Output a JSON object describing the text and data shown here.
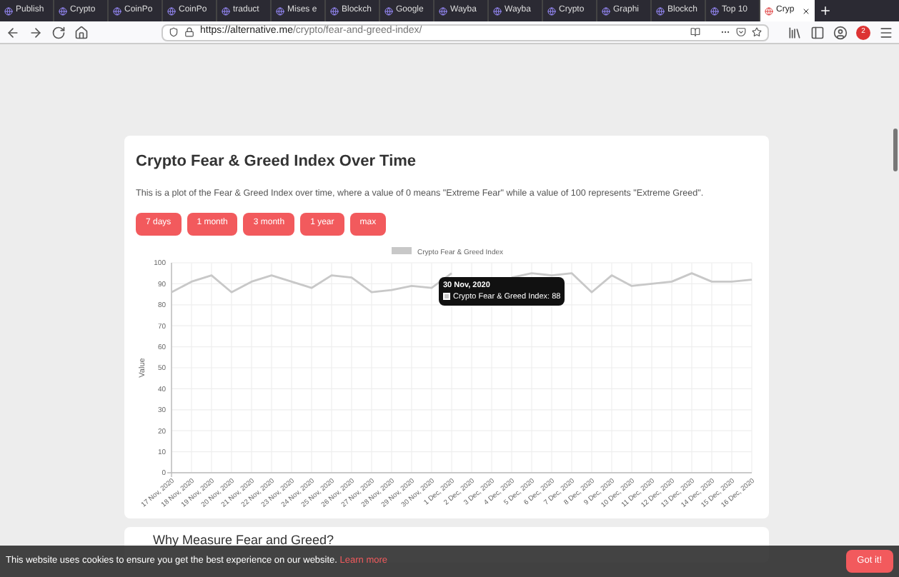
{
  "browser": {
    "tabs": [
      {
        "label": "Publish",
        "selected": false
      },
      {
        "label": "Crypto",
        "selected": false
      },
      {
        "label": "CoinPo",
        "selected": false
      },
      {
        "label": "CoinPo",
        "selected": false
      },
      {
        "label": "traduct",
        "selected": false
      },
      {
        "label": "Mises e",
        "selected": false
      },
      {
        "label": "Blockch",
        "selected": false
      },
      {
        "label": "Google",
        "selected": false
      },
      {
        "label": "Wayba",
        "selected": false
      },
      {
        "label": "Wayba",
        "selected": false
      },
      {
        "label": "Crypto",
        "selected": false
      },
      {
        "label": "Graphi",
        "selected": false
      },
      {
        "label": "Blockch",
        "selected": false
      },
      {
        "label": "Top 10",
        "selected": false
      },
      {
        "label": "Cryp",
        "selected": true
      }
    ],
    "url_host": "https://alternative.me",
    "url_path": "/crypto/fear-and-greed-index/",
    "adblock_count": "2"
  },
  "card": {
    "title": "Crypto Fear & Greed Index Over Time",
    "description": "This is a plot of the Fear & Greed Index over time, where a value of 0 means \"Extreme Fear\" while a value of 100 represents \"Extreme Greed\".",
    "buttons": [
      "7 days",
      "1 month",
      "3 month",
      "1 year",
      "max"
    ],
    "tooltip": {
      "title": "30 Nov, 2020",
      "label": "Crypto Fear & Greed Index: 88"
    },
    "chart_data": {
      "type": "line",
      "grid": true,
      "ylabel": "Value",
      "ylim": [
        0,
        100
      ],
      "yticks": [
        0,
        10,
        20,
        30,
        40,
        50,
        60,
        70,
        80,
        90,
        100
      ],
      "categories": [
        "17 Nov, 2020",
        "18 Nov, 2020",
        "19 Nov, 2020",
        "20 Nov, 2020",
        "21 Nov, 2020",
        "22 Nov, 2020",
        "23 Nov, 2020",
        "24 Nov, 2020",
        "25 Nov, 2020",
        "26 Nov, 2020",
        "27 Nov, 2020",
        "28 Nov, 2020",
        "29 Nov, 2020",
        "30 Nov, 2020",
        "1 Dec, 2020",
        "2 Dec, 2020",
        "3 Dec, 2020",
        "4 Dec, 2020",
        "5 Dec, 2020",
        "6 Dec, 2020",
        "7 Dec, 2020",
        "8 Dec, 2020",
        "9 Dec, 2020",
        "10 Dec, 2020",
        "11 Dec, 2020",
        "12 Dec, 2020",
        "13 Dec, 2020",
        "14 Dec, 2020",
        "15 Dec, 2020",
        "16 Dec, 2020"
      ],
      "series": [
        {
          "name": "Crypto Fear & Greed Index",
          "color": "#c8c8c8",
          "values": [
            86,
            91,
            94,
            86,
            91,
            94,
            91,
            88,
            94,
            93,
            86,
            87,
            89,
            88,
            95,
            null,
            null,
            93,
            95,
            94,
            95,
            86,
            94,
            89,
            90,
            91,
            95,
            91,
            91,
            92
          ]
        }
      ]
    }
  },
  "next_heading": "Why Measure Fear and Greed?",
  "cookie_bar": {
    "text": "This website uses cookies to ensure you get the best experience on our website.",
    "link": "Learn more",
    "button": "Got it!"
  }
}
